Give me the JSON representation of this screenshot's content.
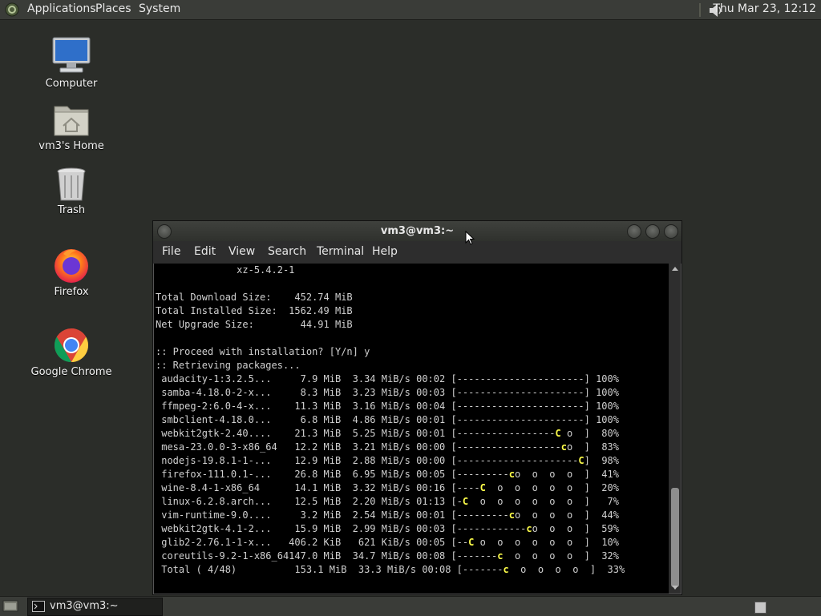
{
  "top_panel": {
    "menus": [
      "Applications",
      "Places",
      "System"
    ],
    "clock": "Thu Mar 23, 12:12"
  },
  "desktop_icons": [
    {
      "label": "Computer",
      "icon": "computer-icon"
    },
    {
      "label": "vm3's Home",
      "icon": "home-folder-icon"
    },
    {
      "label": "Trash",
      "icon": "trash-icon"
    },
    {
      "label": "Firefox",
      "icon": "firefox-icon"
    },
    {
      "label": "Google Chrome",
      "icon": "chrome-icon"
    }
  ],
  "window": {
    "title": "vm3@vm3:~",
    "menus": [
      "File",
      "Edit",
      "View",
      "Search",
      "Terminal",
      "Help"
    ]
  },
  "terminal_lines": [
    "              xz-5.4.2-1",
    "",
    "Total Download Size:    452.74 MiB",
    "Total Installed Size:  1562.49 MiB",
    "Net Upgrade Size:        44.91 MiB",
    "",
    ":: Proceed with installation? [Y/n] y",
    ":: Retrieving packages...",
    " audacity-1:3.2.5...     7.9 MiB  3.34 MiB/s 00:02 [----------------------] 100%",
    " samba-4.18.0-2-x...     8.3 MiB  3.23 MiB/s 00:03 [----------------------] 100%",
    " ffmpeg-2:6.0-4-x...    11.3 MiB  3.16 MiB/s 00:04 [----------------------] 100%",
    " smbclient-4.18.0...     6.8 MiB  4.86 MiB/s 00:01 [----------------------] 100%",
    " webkit2gtk-2.40....    21.3 MiB  5.25 MiB/s 00:01 [-----------------C o  ]  80%",
    " mesa-23.0.0-3-x86_64   12.2 MiB  3.21 MiB/s 00:00 [------------------co  ]  83%",
    " nodejs-19.8.1-1-...    12.9 MiB  2.88 MiB/s 00:00 [---------------------C]  98%",
    " firefox-111.0.1-...    26.8 MiB  6.95 MiB/s 00:05 [---------co  o  o  o  ]  41%",
    " wine-8.4-1-x86_64      14.1 MiB  3.32 MiB/s 00:16 [----C  o  o  o  o  o  ]  20%",
    " linux-6.2.8.arch...    12.5 MiB  2.20 MiB/s 01:13 [-C  o  o  o  o  o  o  ]   7%",
    " vim-runtime-9.0....     3.2 MiB  2.54 MiB/s 00:01 [---------co  o  o  o  ]  44%",
    " webkit2gtk-4.1-2...    15.9 MiB  2.99 MiB/s 00:03 [------------co  o  o  ]  59%",
    " glib2-2.76.1-1-x...   406.2 KiB   621 KiB/s 00:05 [--C o  o  o  o  o  o  ]  10%",
    " coreutils-9.2-1-x86_64147.0 MiB  34.7 MiB/s 00:08 [-------c  o  o  o  o  ]  32%",
    " Total ( 4/48)          153.1 MiB  33.3 MiB/s 00:08 [-------c  o  o  o  o  ]  33%"
  ],
  "taskbar": {
    "task_label": "vm3@vm3:~"
  },
  "colors": {
    "desktop": "#2b2d29",
    "panel": "#3a3c38",
    "terminal_bg": "#000000",
    "pacman": "#ffff4a"
  }
}
